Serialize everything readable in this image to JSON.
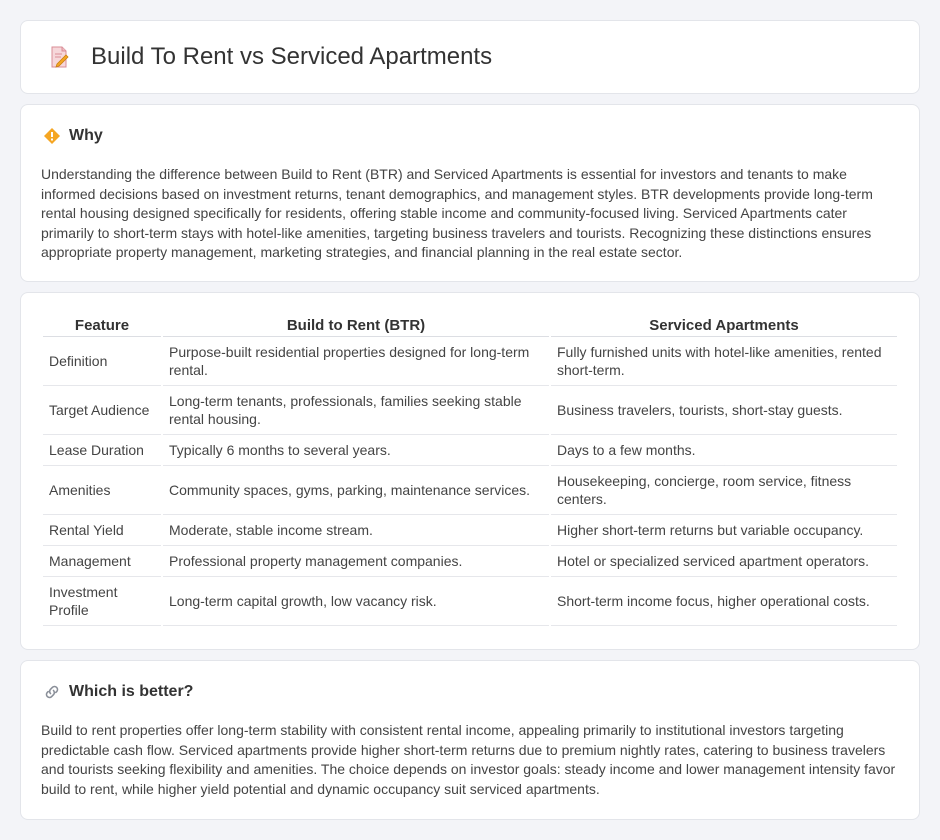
{
  "page": {
    "title": "Build To Rent vs Serviced Apartments"
  },
  "why": {
    "heading": "Why",
    "text": "Understanding the difference between Build to Rent (BTR) and Serviced Apartments is essential for investors and tenants to make informed decisions based on investment returns, tenant demographics, and management styles. BTR developments provide long-term rental housing designed specifically for residents, offering stable income and community-focused living. Serviced Apartments cater primarily to short-term stays with hotel-like amenities, targeting business travelers and tourists. Recognizing these distinctions ensures appropriate property management, marketing strategies, and financial planning in the real estate sector."
  },
  "table": {
    "headers": [
      "Feature",
      "Build to Rent (BTR)",
      "Serviced Apartments"
    ],
    "rows": [
      [
        "Definition",
        "Purpose-built residential properties designed for long-term rental.",
        "Fully furnished units with hotel-like amenities, rented short-term."
      ],
      [
        "Target Audience",
        "Long-term tenants, professionals, families seeking stable rental housing.",
        "Business travelers, tourists, short-stay guests."
      ],
      [
        "Lease Duration",
        "Typically 6 months to several years.",
        "Days to a few months."
      ],
      [
        "Amenities",
        "Community spaces, gyms, parking, maintenance services.",
        "Housekeeping, concierge, room service, fitness centers."
      ],
      [
        "Rental Yield",
        "Moderate, stable income stream.",
        "Higher short-term returns but variable occupancy."
      ],
      [
        "Management",
        "Professional property management companies.",
        "Hotel or specialized serviced apartment operators."
      ],
      [
        "Investment Profile",
        "Long-term capital growth, low vacancy risk.",
        "Short-term income focus, higher operational costs."
      ]
    ]
  },
  "better": {
    "heading": "Which is better?",
    "text": "Build to rent properties offer long-term stability with consistent rental income, appealing primarily to institutional investors targeting predictable cash flow. Serviced apartments provide higher short-term returns due to premium nightly rates, catering to business travelers and tourists seeking flexibility and amenities. The choice depends on investor goals: steady income and lower management intensity favor build to rent, while higher yield potential and dynamic occupancy suit serviced apartments."
  },
  "icons": {
    "title": "document-pencil-icon",
    "why": "diamond-warning-icon",
    "better": "link-icon"
  },
  "colors": {
    "accent_orange": "#f5a623",
    "doc_pink": "#e8a0a8"
  }
}
